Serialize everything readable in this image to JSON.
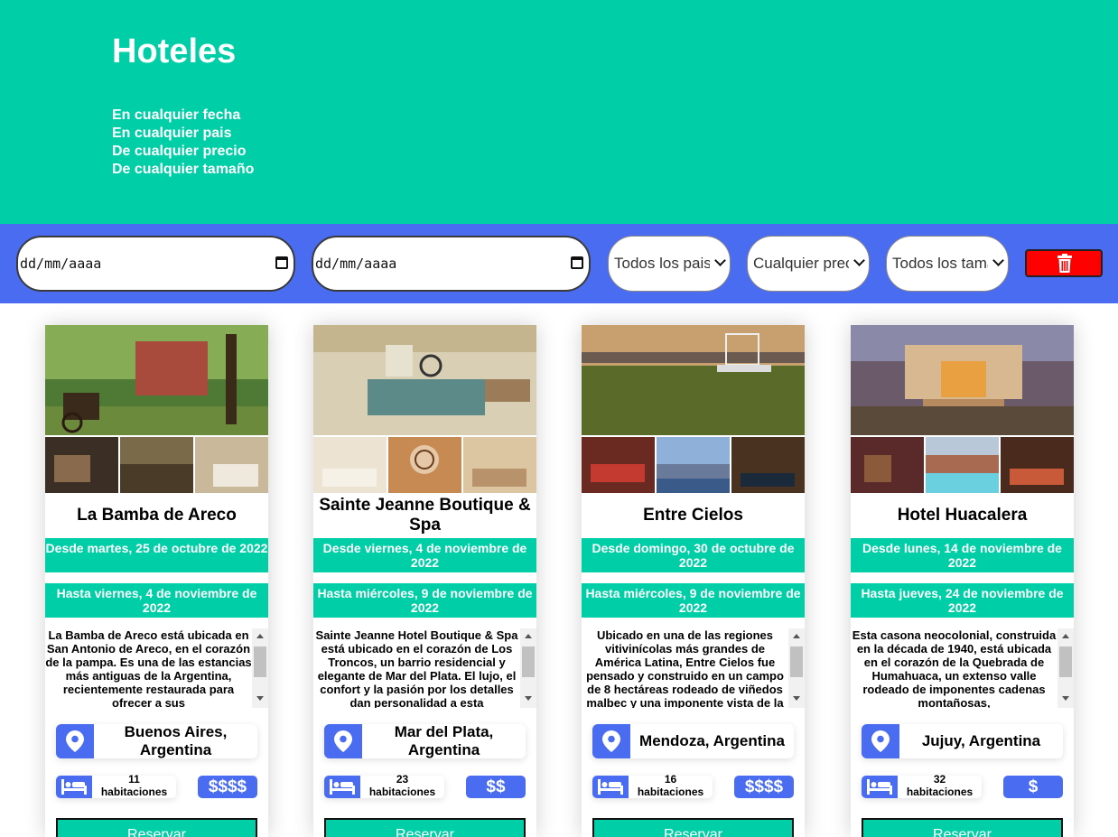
{
  "hero": {
    "title": "Hoteles",
    "taglines": [
      "En cualquier fecha",
      "En cualquier pais",
      "De cualquier precio",
      "De cualquier tamaño"
    ]
  },
  "filters": {
    "date_from": "dd/mm/aaaa",
    "date_to": "dd/mm/aaaa",
    "country": "Todos los paises",
    "price": "Cualquier precio",
    "size": "Todos los tamaños",
    "clear_icon": "trash-icon"
  },
  "colors": {
    "primary": "#00cea6",
    "secondary": "#4a6cf0",
    "danger": "#ff0000"
  },
  "hotels": [
    {
      "name": "La Bamba de Areco",
      "from": "Desde martes, 25 de octubre de 2022",
      "to": "Hasta viernes, 4 de noviembre de 2022",
      "description": "La Bamba de Areco está ubicada en San Antonio de Areco, en el corazón de la pampa. Es una de las estancias más antiguas de la Argentina, recientemente restaurada para ofrecer a sus",
      "location": "Buenos Aires, Argentina",
      "rooms": "11",
      "rooms_label": "habitaciones",
      "price": "$$$$",
      "reserve": "Reservar"
    },
    {
      "name": "Sainte Jeanne Boutique & Spa",
      "from": "Desde viernes, 4 de noviembre de 2022",
      "to": "Hasta miércoles, 9 de noviembre de 2022",
      "description": "Sainte Jeanne Hotel Boutique & Spa está ubicado en el corazón de Los Troncos, un barrio residencial y elegante de Mar del Plata. El lujo, el confort y la pasión por los detalles dan personalidad a esta",
      "location": "Mar del Plata, Argentina",
      "rooms": "23",
      "rooms_label": "habitaciones",
      "price": "$$",
      "reserve": "Reservar"
    },
    {
      "name": "Entre Cielos",
      "from": "Desde domingo, 30 de octubre de 2022",
      "to": "Hasta miércoles, 9 de noviembre de 2022",
      "description": "Ubicado en una de las regiones vitivinícolas más grandes de América Latina, Entre Cielos fue pensado y construido en un campo de 8 hectáreas rodeado de viñedos malbec y una imponente vista de la",
      "location": "Mendoza, Argentina",
      "rooms": "16",
      "rooms_label": "habitaciones",
      "price": "$$$$",
      "reserve": "Reservar"
    },
    {
      "name": "Hotel Huacalera",
      "from": "Desde lunes, 14 de noviembre de 2022",
      "to": "Hasta jueves, 24 de noviembre de 2022",
      "description": "Esta casona neocolonial, construida en la década de 1940, está ubicada en el corazón de la Quebrada de Humahuaca, un extenso valle rodeado de imponentes cadenas montañosas,",
      "location": "Jujuy, Argentina",
      "rooms": "32",
      "rooms_label": "habitaciones",
      "price": "$",
      "reserve": "Reservar"
    }
  ]
}
